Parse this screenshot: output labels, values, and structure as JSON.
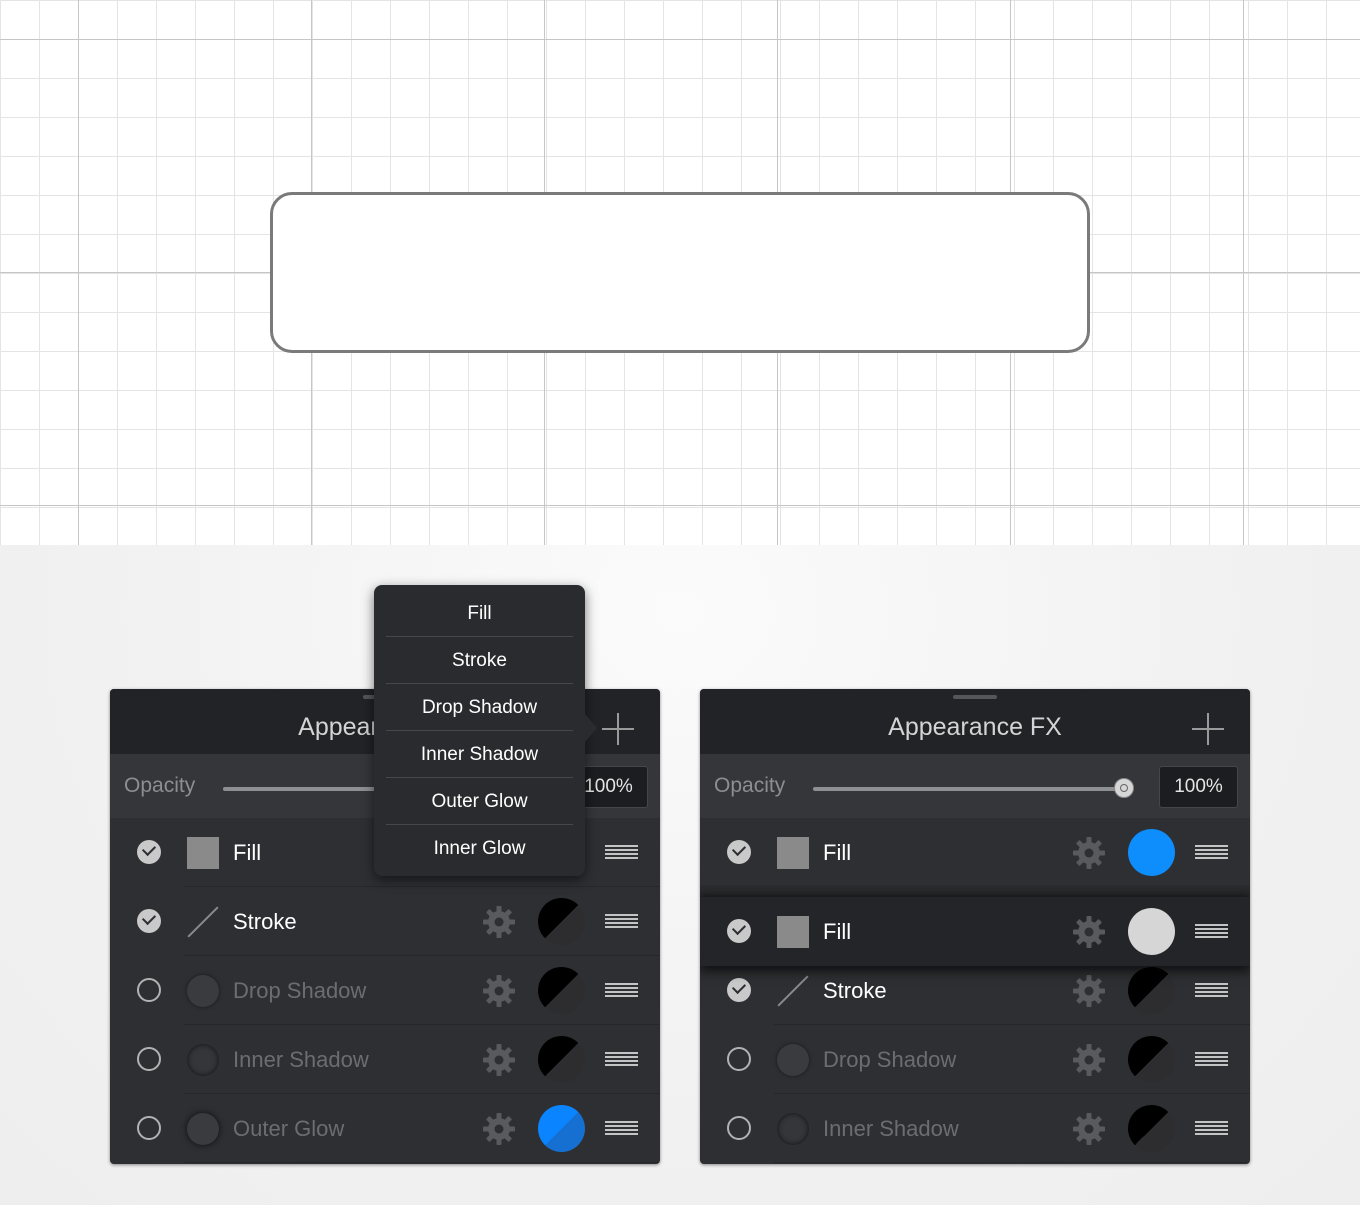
{
  "canvas": {
    "grid": "on"
  },
  "left_panel": {
    "title": "Appearance FX",
    "opacity_label": "Opacity",
    "opacity_value": "100%",
    "opacity_level": 1.0,
    "rows": [
      {
        "label": "Fill",
        "enabled": true,
        "type": "fill",
        "swatch": "light"
      },
      {
        "label": "Stroke",
        "enabled": true,
        "type": "stroke",
        "swatch": "dark"
      },
      {
        "label": "Drop Shadow",
        "enabled": false,
        "type": "drop-shadow",
        "swatch": "dark"
      },
      {
        "label": "Inner Shadow",
        "enabled": false,
        "type": "inner-shadow",
        "swatch": "dark"
      },
      {
        "label": "Outer Glow",
        "enabled": false,
        "type": "outer-glow",
        "swatch": "blue"
      }
    ]
  },
  "add_menu": {
    "items": [
      "Fill",
      "Stroke",
      "Drop Shadow",
      "Inner Shadow",
      "Outer Glow",
      "Inner Glow"
    ]
  },
  "right_panel": {
    "title": "Appearance FX",
    "opacity_label": "Opacity",
    "opacity_value": "100%",
    "opacity_level": 1.0,
    "rows": [
      {
        "label": "Fill",
        "enabled": true,
        "type": "fill",
        "swatch": "solidblue",
        "color": "#0d8efc"
      },
      {
        "label": "Fill",
        "enabled": true,
        "type": "fill",
        "swatch": "light",
        "color": "#d6d6d6",
        "dragging": true
      },
      {
        "label": "Stroke",
        "enabled": true,
        "type": "stroke",
        "swatch": "dark"
      },
      {
        "label": "Drop Shadow",
        "enabled": false,
        "type": "drop-shadow",
        "swatch": "dark"
      },
      {
        "label": "Inner Shadow",
        "enabled": false,
        "type": "inner-shadow",
        "swatch": "dark"
      }
    ]
  },
  "colors": {
    "accent_blue": "#0a84ff",
    "panel_bg": "#2e2f33",
    "header_bg": "#222326"
  }
}
